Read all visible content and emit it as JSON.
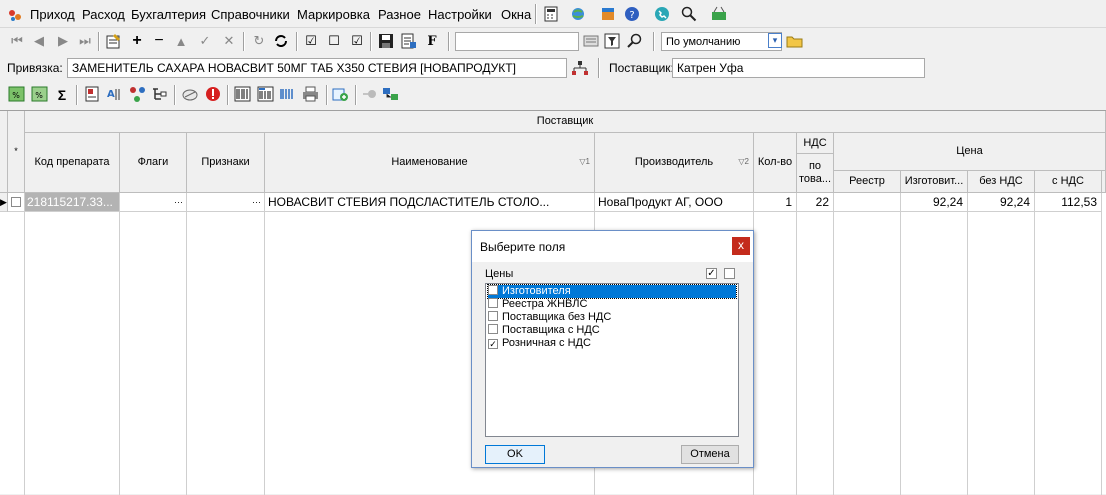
{
  "menu": {
    "items": [
      "Приход",
      "Расход",
      "Бухгалтерия",
      "Справочники",
      "Маркировка",
      "Разное",
      "Настройки",
      "Окна"
    ]
  },
  "toolbar2": {
    "search_value": "",
    "preset_value": "По умолчанию"
  },
  "binding": {
    "label": "Привязка:",
    "value": "ЗАМЕНИТЕЛЬ САХАРА НОВАСВИТ 50МГ ТАБ Х350 СТЕВИЯ [НОВАПРОДУКТ]",
    "supplier_label": "Поставщик:",
    "supplier_value": "Катрен Уфа"
  },
  "grid": {
    "group_header": "Поставщик",
    "select_marker": "*",
    "headers": {
      "code": "Код препарата",
      "flags": "Флаги",
      "signs": "Признаки",
      "name": "Наименование",
      "name_sort": "▽1",
      "maker": "Производитель",
      "maker_sort": "▽2",
      "qty": "Кол-во",
      "vat_group": "НДС",
      "vat_sub": "по това...",
      "price_group": "Цена",
      "price_registry": "Реестр",
      "price_maker": "Изготовит...",
      "price_no_vat": "без НДС",
      "price_with_vat": "с НДС"
    },
    "row": {
      "indicator": "▶",
      "code": "218115217.33...",
      "flags": "···",
      "signs": "···",
      "name": "НОВАСВИТ СТЕВИЯ ПОДСЛАСТИТЕЛЬ СТОЛО...",
      "maker": "НоваПродукт АГ, ООО",
      "qty": "1",
      "vat": "22",
      "price_registry": "",
      "price_maker": "92,24",
      "price_no_vat": "92,24",
      "price_with_vat": "112,53"
    }
  },
  "dialog": {
    "title": "Выберите поля",
    "close": "x",
    "group_label": "Цены",
    "items": [
      {
        "label": "Изготовителя",
        "checked": false,
        "selected": true
      },
      {
        "label": "Реестра ЖНВЛС",
        "checked": false,
        "selected": false
      },
      {
        "label": "Поставщика без НДС",
        "checked": false,
        "selected": false
      },
      {
        "label": "Поставщика с НДС",
        "checked": false,
        "selected": false
      },
      {
        "label": "Розничная с НДС",
        "checked": true,
        "selected": false
      }
    ],
    "ok": "OK",
    "cancel": "Отмена"
  },
  "colors": {
    "accent": "#0078d7",
    "close": "#c42b1c",
    "grid_line": "#cfcfcf"
  }
}
